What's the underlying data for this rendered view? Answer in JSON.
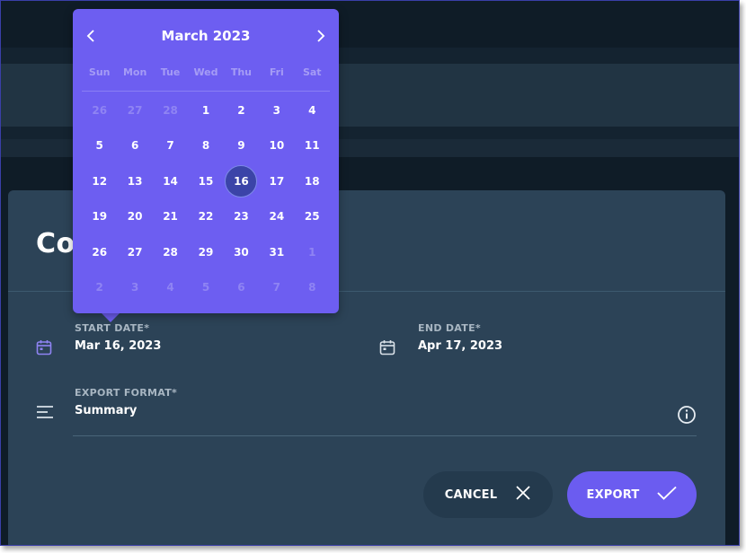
{
  "dialog": {
    "title": "Co",
    "start_date": {
      "label": "START DATE*",
      "value": "Mar 16, 2023",
      "icon": "calendar-icon"
    },
    "end_date": {
      "label": "END DATE*",
      "value": "Apr 17, 2023",
      "icon": "calendar-icon"
    },
    "export_format": {
      "label": "EXPORT FORMAT*",
      "value": "Summary",
      "icon": "list-icon",
      "info_icon": "info-icon"
    },
    "cancel_label": "CANCEL",
    "export_label": "EXPORT"
  },
  "calendar": {
    "month_label": "March 2023",
    "prev_icon": "chevron-left-icon",
    "next_icon": "chevron-right-icon",
    "weekdays": [
      "Sun",
      "Mon",
      "Tue",
      "Wed",
      "Thu",
      "Fri",
      "Sat"
    ],
    "days": [
      {
        "label": "26",
        "muted": true
      },
      {
        "label": "27",
        "muted": true
      },
      {
        "label": "28",
        "muted": true
      },
      {
        "label": "1"
      },
      {
        "label": "2"
      },
      {
        "label": "3"
      },
      {
        "label": "4"
      },
      {
        "label": "5"
      },
      {
        "label": "6"
      },
      {
        "label": "7"
      },
      {
        "label": "8"
      },
      {
        "label": "9"
      },
      {
        "label": "10"
      },
      {
        "label": "11"
      },
      {
        "label": "12"
      },
      {
        "label": "13"
      },
      {
        "label": "14"
      },
      {
        "label": "15"
      },
      {
        "label": "16",
        "selected": true
      },
      {
        "label": "17"
      },
      {
        "label": "18"
      },
      {
        "label": "19"
      },
      {
        "label": "20"
      },
      {
        "label": "21"
      },
      {
        "label": "22"
      },
      {
        "label": "23"
      },
      {
        "label": "24"
      },
      {
        "label": "25"
      },
      {
        "label": "26"
      },
      {
        "label": "27"
      },
      {
        "label": "28"
      },
      {
        "label": "29"
      },
      {
        "label": "30"
      },
      {
        "label": "31"
      },
      {
        "label": "1",
        "muted": true
      },
      {
        "label": "2",
        "muted": true
      },
      {
        "label": "3",
        "muted": true
      },
      {
        "label": "4",
        "muted": true
      },
      {
        "label": "5",
        "muted": true
      },
      {
        "label": "6",
        "muted": true
      },
      {
        "label": "7",
        "muted": true
      },
      {
        "label": "8",
        "muted": true
      }
    ]
  },
  "colors": {
    "accent": "#6d5ef1",
    "selected_day": "#3b44a8",
    "dialog_bg": "#2c4357",
    "app_bg": "#0f1c27"
  }
}
